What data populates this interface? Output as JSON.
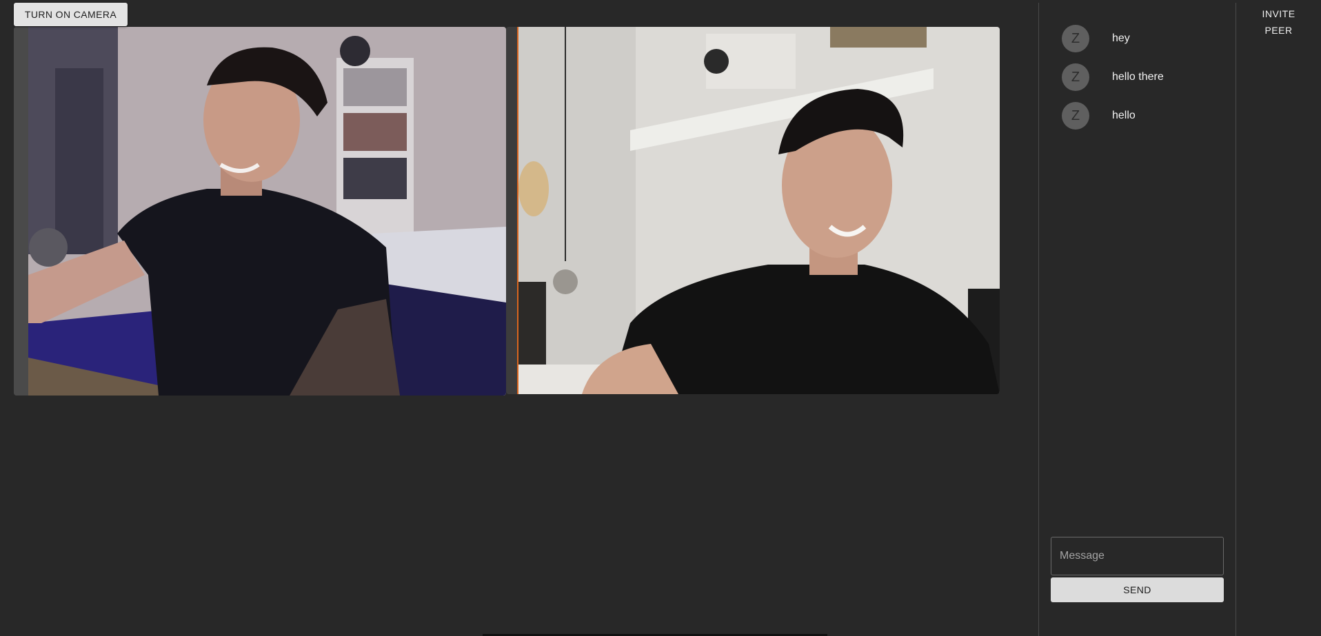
{
  "toolbar": {
    "camera_button_label": "TURN ON CAMERA"
  },
  "videos": {
    "local": {
      "subject": "person-in-black-tshirt-bedroom"
    },
    "remote": {
      "subject": "person-in-black-tshirt-smiling"
    }
  },
  "chat": {
    "messages": [
      {
        "avatar": "Z",
        "text": "hey"
      },
      {
        "avatar": "Z",
        "text": "hello there"
      },
      {
        "avatar": "Z",
        "text": "hello"
      }
    ],
    "input_placeholder": "Message",
    "input_value": "",
    "send_label": "SEND"
  },
  "sidebar": {
    "invite_line1": "INVITE",
    "invite_line2": "PEER"
  },
  "colors": {
    "background": "#282828",
    "avatar": "#5f5f5f",
    "button": "#e3e3e3",
    "active_speaker_border": "#d9661f"
  }
}
